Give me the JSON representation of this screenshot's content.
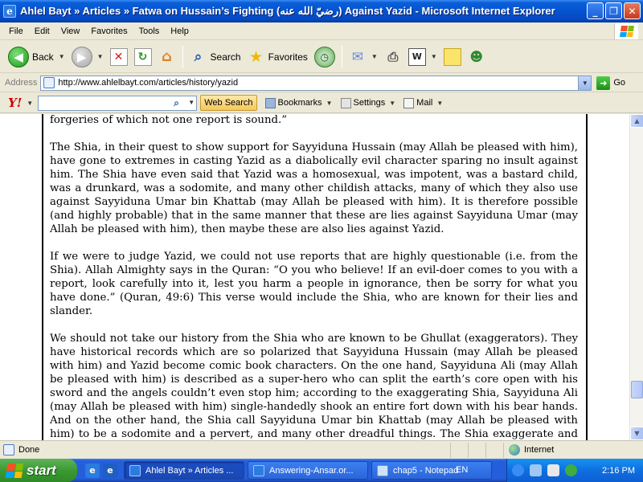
{
  "window": {
    "title": "Ahlel Bayt » Articles » Fatwa on Hussain’s Fighting (رضيّ الله عنه) Against Yazid - Microsoft Internet Explorer",
    "minimize_glyph": "_",
    "restore_glyph": "❐",
    "close_glyph": "✕"
  },
  "menu": [
    "File",
    "Edit",
    "View",
    "Favorites",
    "Tools",
    "Help"
  ],
  "toolbar": {
    "back_label": "Back",
    "search_label": "Search",
    "favorites_label": "Favorites"
  },
  "address": {
    "label": "Address",
    "url": "http://www.ahlelbayt.com/articles/history/yazid",
    "go_label": "Go"
  },
  "yahoo": {
    "logo": "Y!",
    "search_value": "",
    "web_search_label": "Web Search",
    "bookmarks_label": "Bookmarks",
    "settings_label": "Settings",
    "mail_label": "Mail"
  },
  "article": {
    "paragraphs": [
      "forgeries of which not one report is sound.”",
      "The Shia, in their quest to show support for Sayyiduna Hussain (may Allah be pleased with him), have gone to extremes in casting Yazid as a diabolically evil character sparing no insult against him. The Shia have even said that Yazid was a homosexual, was impotent, was a bastard child, was a drunkard, was a sodomite, and many other childish attacks, many of which they also use against Sayyiduna Umar bin Khattab (may Allah be pleased with him). It is therefore possible (and highly probable) that in the same manner that these are lies against Sayyiduna Umar (may Allah be pleased with him), then maybe these are also lies against Yazid.",
      "If we were to judge Yazid, we could not use reports that are highly questionable (i.e. from the Shia). Allah Almighty says in the Quran: “O you who believe! If an evil-doer comes to you with a report, look carefully into it, lest you harm a people in ignorance, then be sorry for what you have done.” (Quran, 49:6) This verse would include the Shia, who are known for their lies and slander.",
      "We should not take our history from the Shia who are known to be Ghullat (exaggerators). They have historical records which are so polarized that Sayyiduna Hussain (may Allah be pleased with him) and Yazid become comic book characters. On the one hand, Sayyiduna Ali (may Allah be pleased with him) is described as a super-hero who can split the earth’s core open with his sword and the angels couldn’t even stop him; according to the exaggerating Shia, Sayyiduna Ali (may Allah be pleased with him) single-handedly shook an entire fort down with his bear hands. And on the other hand, the Shia call Sayyiduna Umar bin Khattab (may Allah be pleased with him) to be a sodomite and a pervert, and many other dreadful things. The Shia exaggerate and make everything into a fairy-tale between good and evil. So how can we use the Shia accounts of history seriously, and how can we pass judgement on a person based on"
    ]
  },
  "status": {
    "text": "Done",
    "zone": "Internet"
  },
  "taskbar": {
    "start_label": "start",
    "tasks": [
      {
        "label": "Ahlel Bayt » Articles ...",
        "active": true
      },
      {
        "label": "Answering-Ansar.or...",
        "active": false
      },
      {
        "label": "chap5 - Notepad",
        "active": false
      }
    ],
    "lang": "EN",
    "clock": "2:16 PM"
  },
  "colors": {
    "xp_blue": "#0553d0",
    "start_green": "#3a9a32",
    "ie_chrome": "#ece9d8"
  }
}
